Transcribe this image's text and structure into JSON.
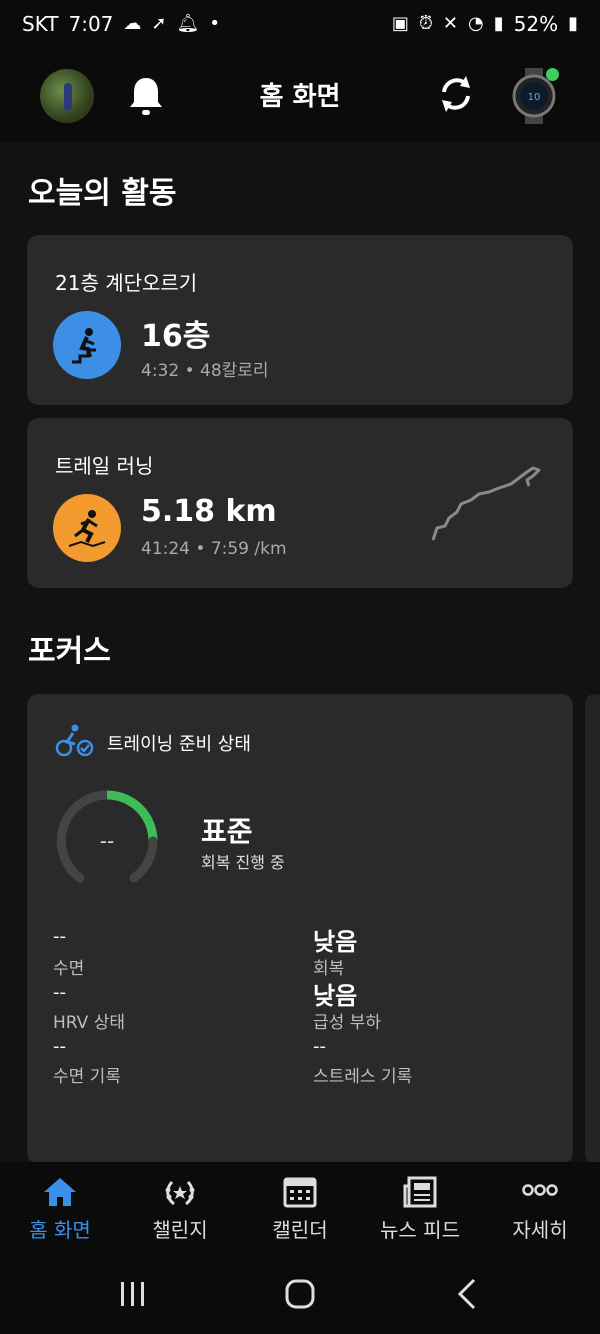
{
  "status_bar": {
    "carrier": "SKT",
    "time": "7:07",
    "battery": "52%"
  },
  "header": {
    "title": "홈 화면",
    "icons": [
      "avatar",
      "bell-icon",
      "sync-icon",
      "watch-icon"
    ]
  },
  "today": {
    "section_title": "오늘의 활동",
    "activities": [
      {
        "label": "21층 계단오르기",
        "main": "16층",
        "sub": "4:32 • 48칼로리",
        "icon": "stair-climb-icon",
        "color": "#3d8fe6"
      },
      {
        "label": "트레일 러닝",
        "main": "5.18 km",
        "sub": "41:24 • 7:59 /km",
        "icon": "trail-run-icon",
        "color": "#f39a2e"
      }
    ]
  },
  "focus": {
    "section_title": "포커스",
    "training_readiness": {
      "title": "트레이닝 준비 상태",
      "gauge_value": "--",
      "status": "표준",
      "status_sub": "회복 진행 중",
      "metrics_left": [
        {
          "value": "--",
          "label": "수면"
        },
        {
          "value": "--",
          "label": "HRV 상태"
        },
        {
          "value": "--",
          "label": "수면 기록"
        }
      ],
      "metrics_right": [
        {
          "value": "낮음",
          "label": "회복"
        },
        {
          "value": "낮음",
          "label": "급성 부하"
        },
        {
          "value": "--",
          "label": "스트레스 기록"
        }
      ]
    }
  },
  "bottom_nav": {
    "items": [
      {
        "label": "홈 화면",
        "icon": "home-icon",
        "active": true
      },
      {
        "label": "챌린지",
        "icon": "laurel-icon",
        "active": false
      },
      {
        "label": "캘린더",
        "icon": "calendar-icon",
        "active": false
      },
      {
        "label": "뉴스 피드",
        "icon": "newsfeed-icon",
        "active": false
      },
      {
        "label": "자세히",
        "icon": "more-icon",
        "active": false
      }
    ]
  },
  "colors": {
    "accent": "#3a8fe8",
    "card": "#2a2a2a",
    "background": "#121212",
    "gauge_green": "#3dbd5a"
  }
}
